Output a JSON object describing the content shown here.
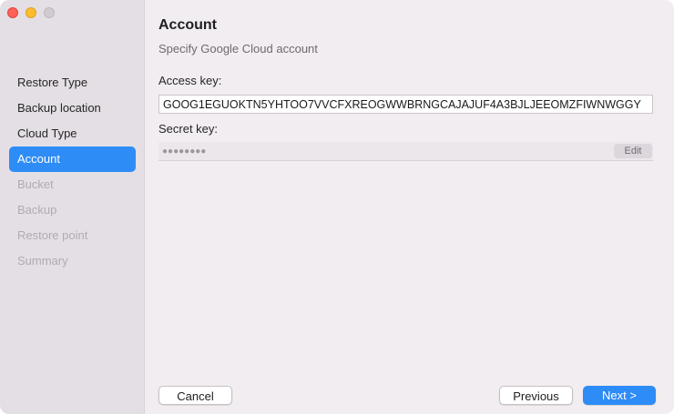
{
  "window": {
    "traffic_lights": [
      "close",
      "minimize",
      "zoom"
    ]
  },
  "sidebar": {
    "items": [
      {
        "label": "Restore Type",
        "state": "normal"
      },
      {
        "label": "Backup location",
        "state": "normal"
      },
      {
        "label": "Cloud Type",
        "state": "normal"
      },
      {
        "label": "Account",
        "state": "selected"
      },
      {
        "label": "Bucket",
        "state": "disabled"
      },
      {
        "label": "Backup",
        "state": "disabled"
      },
      {
        "label": "Restore point",
        "state": "disabled"
      },
      {
        "label": "Summary",
        "state": "disabled"
      }
    ]
  },
  "main": {
    "title": "Account",
    "subtitle": "Specify Google Cloud account",
    "access_key": {
      "label": "Access key:",
      "value": "GOOG1EGUOKTN5YHTOO7VVCFXREOGWWBRNGCAJAJUF4A3BJLJEEOMZFIWNWGGY"
    },
    "secret_key": {
      "label": "Secret key:",
      "masked_value": "●●●●●●●●",
      "edit_label": "Edit"
    }
  },
  "footer": {
    "cancel_label": "Cancel",
    "previous_label": "Previous",
    "next_label": "Next >"
  },
  "colors": {
    "accent": "#2e8cf7",
    "sidebar_bg": "#e4dfe4",
    "content_bg": "#f1edf1",
    "disabled_text": "#b0abb0"
  }
}
